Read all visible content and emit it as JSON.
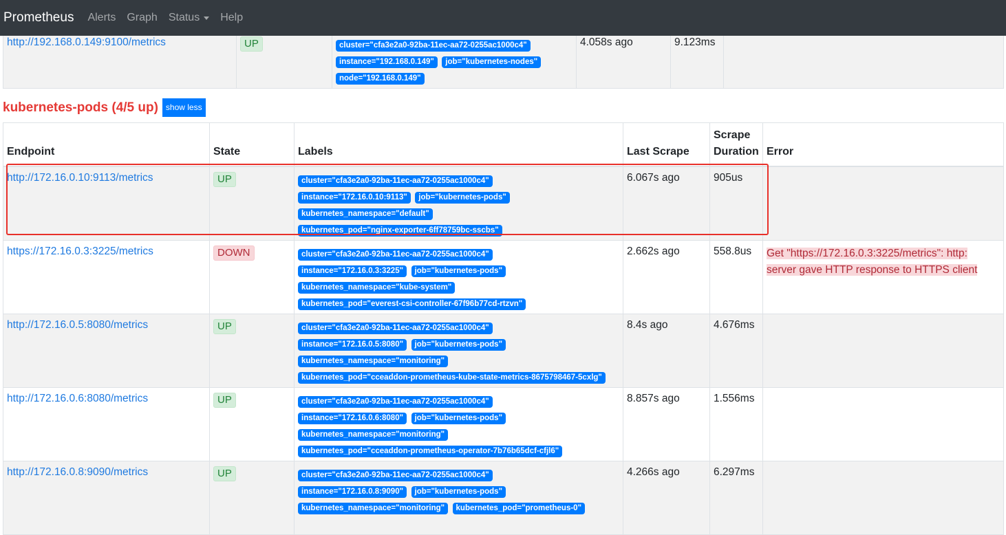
{
  "navbar": {
    "brand": "Prometheus",
    "items": [
      "Alerts",
      "Graph",
      "Status",
      "Help"
    ]
  },
  "top_table": {
    "row": {
      "endpoint": "http://192.168.0.149:9100/metrics",
      "state": "UP",
      "labels": [
        "cluster=\"cfa3e2a0-92ba-11ec-aa72-0255ac1000c4\"",
        "instance=\"192.168.0.149\"",
        "job=\"kubernetes-nodes\"",
        "node=\"192.168.0.149\""
      ],
      "last_scrape": "4.058s ago",
      "scrape_duration": "9.123ms",
      "error": ""
    }
  },
  "section": {
    "title": "kubernetes-pods (4/5 up)",
    "toggle_label": "show less"
  },
  "table": {
    "headers": {
      "endpoint": "Endpoint",
      "state": "State",
      "labels": "Labels",
      "last_scrape": "Last Scrape",
      "scrape_duration": "Scrape Duration",
      "error": "Error"
    },
    "rows": [
      {
        "endpoint": "http://172.16.0.10:9113/metrics",
        "state": "UP",
        "labels": [
          "cluster=\"cfa3e2a0-92ba-11ec-aa72-0255ac1000c4\"",
          "instance=\"172.16.0.10:9113\"",
          "job=\"kubernetes-pods\"",
          "kubernetes_namespace=\"default\"",
          "kubernetes_pod=\"nginx-exporter-6ff78759bc-sscbs\""
        ],
        "last_scrape": "6.067s ago",
        "scrape_duration": "905us",
        "error": ""
      },
      {
        "endpoint": "https://172.16.0.3:3225/metrics",
        "state": "DOWN",
        "labels": [
          "cluster=\"cfa3e2a0-92ba-11ec-aa72-0255ac1000c4\"",
          "instance=\"172.16.0.3:3225\"",
          "job=\"kubernetes-pods\"",
          "kubernetes_namespace=\"kube-system\"",
          "kubernetes_pod=\"everest-csi-controller-67f96b77cd-rtzvn\""
        ],
        "last_scrape": "2.662s ago",
        "scrape_duration": "558.8us",
        "error": "Get \"https://172.16.0.3:3225/metrics\": http: server gave HTTP response to HTTPS client"
      },
      {
        "endpoint": "http://172.16.0.5:8080/metrics",
        "state": "UP",
        "labels": [
          "cluster=\"cfa3e2a0-92ba-11ec-aa72-0255ac1000c4\"",
          "instance=\"172.16.0.5:8080\"",
          "job=\"kubernetes-pods\"",
          "kubernetes_namespace=\"monitoring\"",
          "kubernetes_pod=\"cceaddon-prometheus-kube-state-metrics-8675798467-5cxlg\""
        ],
        "last_scrape": "8.4s ago",
        "scrape_duration": "4.676ms",
        "error": ""
      },
      {
        "endpoint": "http://172.16.0.6:8080/metrics",
        "state": "UP",
        "labels": [
          "cluster=\"cfa3e2a0-92ba-11ec-aa72-0255ac1000c4\"",
          "instance=\"172.16.0.6:8080\"",
          "job=\"kubernetes-pods\"",
          "kubernetes_namespace=\"monitoring\"",
          "kubernetes_pod=\"cceaddon-prometheus-operator-7b76b65dcf-cfjl6\""
        ],
        "last_scrape": "8.857s ago",
        "scrape_duration": "1.556ms",
        "error": ""
      },
      {
        "endpoint": "http://172.16.0.8:9090/metrics",
        "state": "UP",
        "labels": [
          "cluster=\"cfa3e2a0-92ba-11ec-aa72-0255ac1000c4\"",
          "instance=\"172.16.0.8:9090\"",
          "job=\"kubernetes-pods\"",
          "kubernetes_namespace=\"monitoring\"",
          "kubernetes_pod=\"prometheus-0\""
        ],
        "last_scrape": "4.266s ago",
        "scrape_duration": "6.297ms",
        "error": ""
      }
    ]
  },
  "colors": {
    "navbar_bg": "#343a40",
    "link": "#1f7ae0",
    "badge": "#007bff",
    "section_title": "#e53935",
    "up": "#23843a",
    "down": "#b02a37",
    "highlight_box": "#e8302a"
  }
}
